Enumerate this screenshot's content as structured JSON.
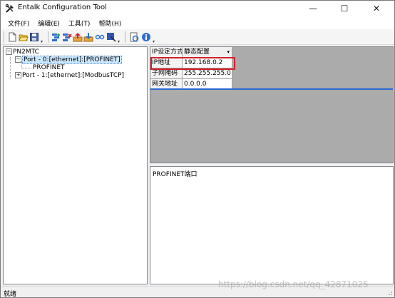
{
  "window": {
    "title": "Entalk Configuration Tool",
    "minimize": "—",
    "maximize": "☐",
    "close": "✕"
  },
  "menu": [
    "文件(F)",
    "编辑(E)",
    "工具(T)",
    "帮助(H)"
  ],
  "toolbar": {
    "icons": [
      "new-file-icon",
      "open-folder-icon",
      "save-icon",
      "add-port-icon",
      "remove-port-icon",
      "upload-icon",
      "download-icon",
      "link-icon",
      "settings-icon",
      "refresh-icon",
      "info-icon"
    ],
    "dropdown_glyph": "▾"
  },
  "tree": {
    "root": "PN2MTC",
    "port0": "Port - 0:[ethernet]:[PROFINET]",
    "port0_child": "PROFINET",
    "port1": "Port - 1:[ethernet]:[ModbusTCP]",
    "collapse_glyph": "−",
    "expand_glyph": "+"
  },
  "properties": {
    "ip_mode_label": "IP设定方式",
    "ip_mode_value": "静态配置",
    "ip_label": "IP地址",
    "ip_value": "192.168.0.2",
    "mask_label": "子网掩码",
    "mask_value": "255.255.255.0",
    "gateway_label": "网关地址",
    "gateway_value": "0.0.0.0"
  },
  "description": "PROFINET端口",
  "status": "就绪",
  "watermark": "https://blog.csdn.net/qq_42871025",
  "colors": {
    "selection": "#cce8ff",
    "highlight_box": "#d0202a",
    "separator": "#2b6ad1"
  }
}
